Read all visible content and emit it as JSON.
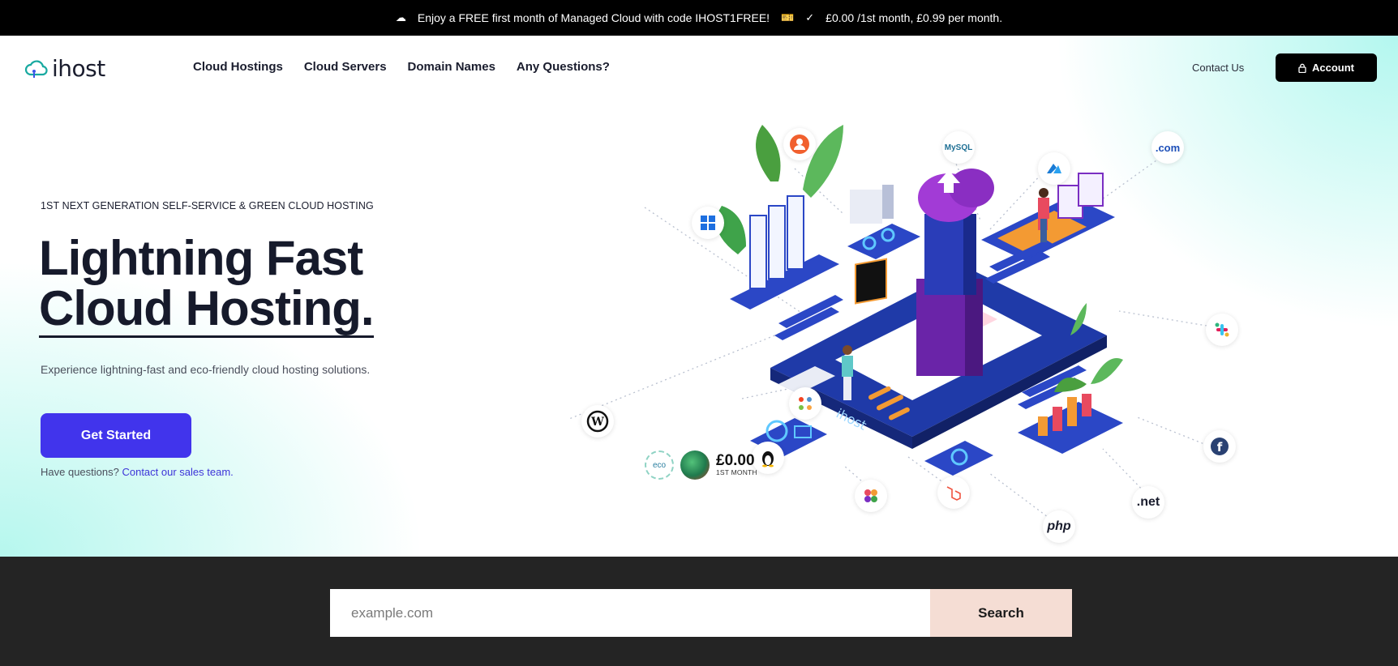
{
  "promo": {
    "message": "Enjoy a FREE first month of Managed Cloud with code IHOST1FREE!",
    "pricing": "£0.00 /1st month, £0.99 per month."
  },
  "nav": {
    "brand": "ihost",
    "items": [
      "Cloud Hostings",
      "Cloud Servers",
      "Domain Names",
      "Any Questions?"
    ],
    "contact_label": "Contact Us",
    "account_label": "Account"
  },
  "hero": {
    "eyebrow": "1ST NEXT GENERATION SELF-SERVICE & GREEN CLOUD HOSTING",
    "headline_line1": "Lightning Fast",
    "headline_line2": "Cloud Hosting.",
    "subtitle": "Experience lightning-fast and eco-friendly cloud hosting solutions.",
    "cta_label": "Get Started",
    "help_prefix": "Have questions?",
    "help_link": "Contact our sales team."
  },
  "illustration": {
    "badges": {
      "mysql": "MySQL",
      "com": ".com",
      "net": ".net",
      "php": "php"
    },
    "price": {
      "eco_label": "eco",
      "amount": "£0.00",
      "caption": "1ST MONTH"
    }
  },
  "search": {
    "placeholder": "example.com",
    "button_label": "Search"
  },
  "colors": {
    "primary": "#4134ec",
    "link": "#3d34d8",
    "search_band": "#242424",
    "search_button": "#f5ddd4",
    "hero_glow": "#b6f7ee"
  }
}
